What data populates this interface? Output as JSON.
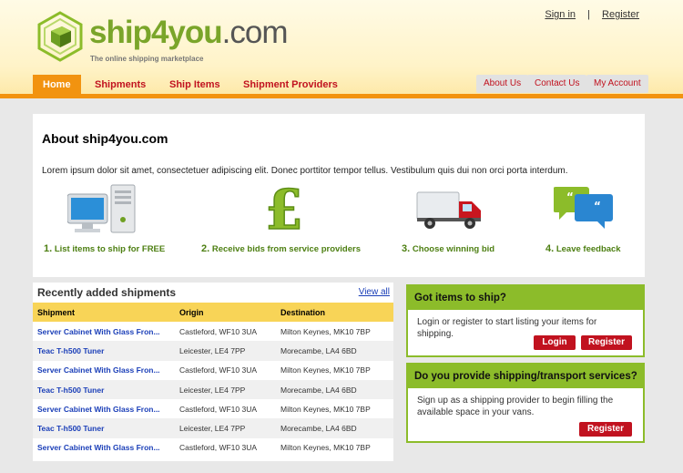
{
  "brand": {
    "name_part1": "ship",
    "name_part2": "4",
    "name_part3": "you",
    "name_domain": ".com",
    "tagline": "The online shipping marketplace",
    "accent_orange": "#f29310",
    "accent_green": "#8cbc2a",
    "accent_red": "#c1121f"
  },
  "toplinks": {
    "signin": "Sign in",
    "separator": "|",
    "register": "Register"
  },
  "nav": {
    "left": [
      {
        "label": "Home",
        "active": true
      },
      {
        "label": "Shipments"
      },
      {
        "label": "Ship Items"
      },
      {
        "label": "Shipment Providers"
      }
    ],
    "right": [
      {
        "label": "About Us"
      },
      {
        "label": "Contact Us"
      },
      {
        "label": "My Account"
      }
    ]
  },
  "about": {
    "title": "About ship4you.com",
    "text": "Lorem ipsum dolor sit amet, consectetuer adipiscing elit. Donec porttitor tempor tellus. Vestibulum quis dui non orci porta interdum.",
    "steps": [
      {
        "num": "1.",
        "label": "List items to ship for FREE",
        "icon": "computer-icon"
      },
      {
        "num": "2.",
        "label": "Receive bids from service providers",
        "icon": "pound-icon"
      },
      {
        "num": "3.",
        "label": "Choose winning bid",
        "icon": "truck-icon"
      },
      {
        "num": "4.",
        "label": "Leave feedback",
        "icon": "speech-bubbles-icon"
      }
    ]
  },
  "shipments": {
    "title": "Recently added shipments",
    "view_all": "View all",
    "columns": [
      "Shipment",
      "Origin",
      "Destination"
    ],
    "rows": [
      [
        "Server Cabinet With Glass Fron...",
        "Castleford, WF10 3UA",
        "Milton Keynes, MK10 7BP"
      ],
      [
        "Teac T-h500 Tuner",
        "Leicester, LE4 7PP",
        "Morecambe, LA4 6BD"
      ],
      [
        "Server Cabinet With Glass Fron...",
        "Castleford, WF10 3UA",
        "Milton Keynes, MK10 7BP"
      ],
      [
        "Teac T-h500 Tuner",
        "Leicester, LE4 7PP",
        "Morecambe, LA4 6BD"
      ],
      [
        "Server Cabinet With Glass Fron...",
        "Castleford, WF10 3UA",
        "Milton Keynes, MK10 7BP"
      ],
      [
        "Teac T-h500 Tuner",
        "Leicester, LE4 7PP",
        "Morecambe, LA4 6BD"
      ],
      [
        "Server Cabinet With Glass Fron...",
        "Castleford, WF10 3UA",
        "Milton Keynes, MK10 7BP"
      ]
    ]
  },
  "panel_items": {
    "title": "Got items to ship?",
    "text": "Login or register to start listing your items for shipping.",
    "login": "Login",
    "register": "Register"
  },
  "panel_providers": {
    "title": "Do you provide shipping/transport services?",
    "text": "Sign up as a shipping provider to begin filling the available space in your vans.",
    "register": "Register"
  }
}
